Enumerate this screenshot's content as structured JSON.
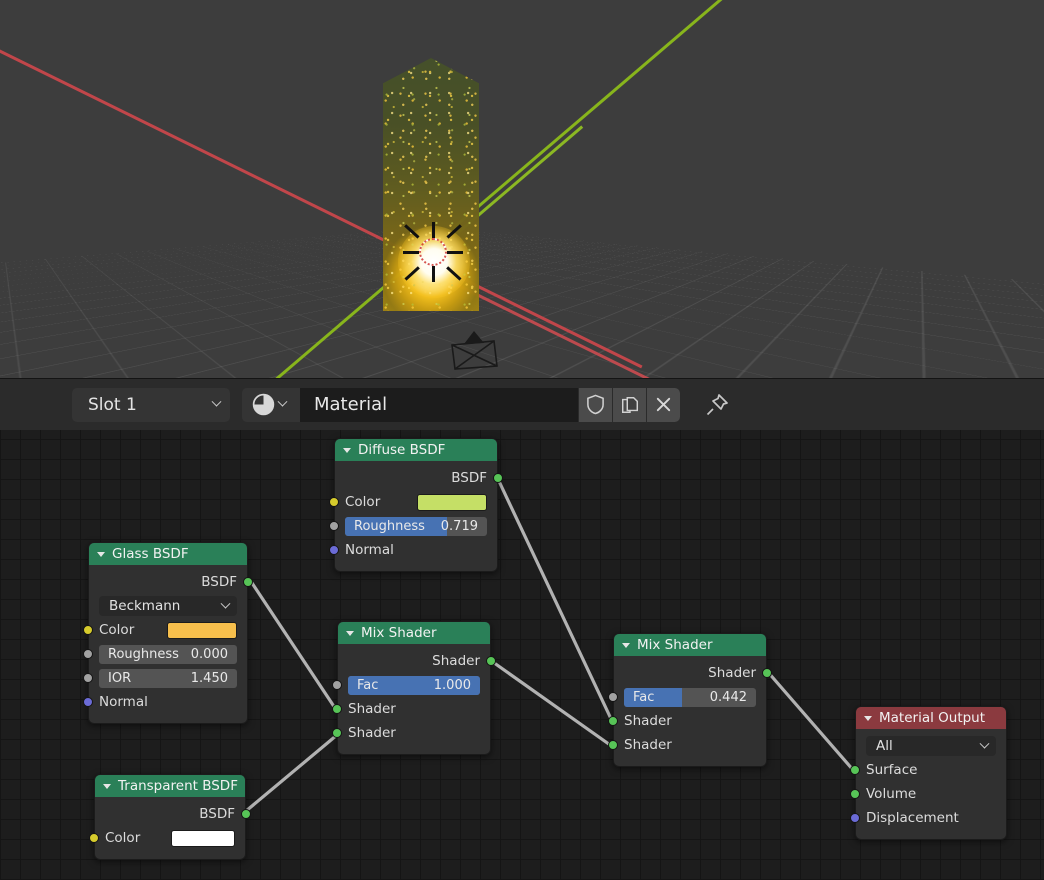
{
  "viewport": {
    "name": "3d-viewport",
    "background_color": "#3d3d3d",
    "axis_x_color": "#c1464a",
    "axis_y_color": "#88b51c",
    "objects": [
      "emissive-cylinder",
      "camera",
      "3d-cursor"
    ]
  },
  "header": {
    "slot_label": "Slot 1",
    "material_name": "Material",
    "buttons": {
      "browse_icon": "material-sphere-icon",
      "fake_user_icon": "shield-icon",
      "new_material_icon": "copy-icon",
      "unlink_icon": "close-x-icon",
      "pin_icon": "pin-icon"
    }
  },
  "nodes": {
    "diffuse": {
      "title": "Diffuse BSDF",
      "header_color": "#2a8058",
      "output_label": "BSDF",
      "color_label": "Color",
      "color_value": "#c5df66",
      "roughness_label": "Roughness",
      "roughness_value": "0.719",
      "roughness_fill_pct": 72,
      "normal_label": "Normal"
    },
    "glass": {
      "title": "Glass BSDF",
      "header_color": "#2a8058",
      "output_label": "BSDF",
      "distribution": "Beckmann",
      "color_label": "Color",
      "color_value": "#f7bf4c",
      "roughness_label": "Roughness",
      "roughness_value": "0.000",
      "roughness_fill_pct": 0,
      "ior_label": "IOR",
      "ior_value": "1.450",
      "normal_label": "Normal"
    },
    "transparent": {
      "title": "Transparent BSDF",
      "header_color": "#2a8058",
      "output_label": "BSDF",
      "color_label": "Color",
      "color_value": "#ffffff"
    },
    "mix1": {
      "title": "Mix Shader",
      "header_color": "#2a8058",
      "output_label": "Shader",
      "fac_label": "Fac",
      "fac_value": "1.000",
      "fac_fill_pct": 100,
      "shader_a_label": "Shader",
      "shader_b_label": "Shader"
    },
    "mix2": {
      "title": "Mix Shader",
      "header_color": "#2a8058",
      "output_label": "Shader",
      "fac_label": "Fac",
      "fac_value": "0.442",
      "fac_fill_pct": 44,
      "shader_a_label": "Shader",
      "shader_b_label": "Shader"
    },
    "output": {
      "title": "Material Output",
      "header_color": "#8b3a3f",
      "target": "All",
      "surface_label": "Surface",
      "volume_label": "Volume",
      "displacement_label": "Displacement"
    }
  },
  "wire_color": "#b2b2b2"
}
